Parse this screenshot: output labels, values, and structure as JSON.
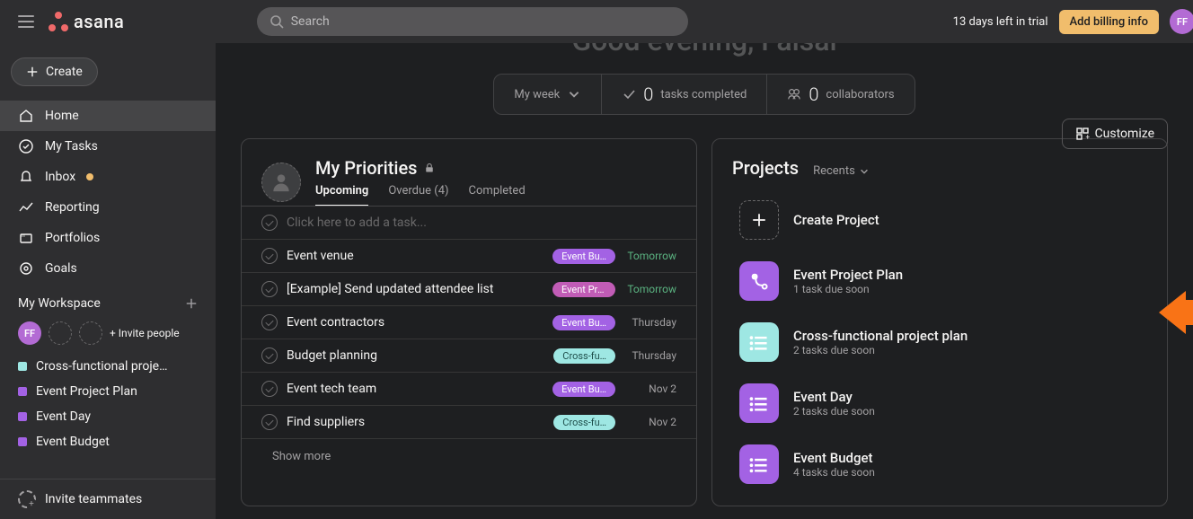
{
  "topbar": {
    "search_placeholder": "Search",
    "trial_text": "13 days left in trial",
    "billing_label": "Add billing info",
    "avatar_initials": "FF"
  },
  "sidebar": {
    "create_label": "Create",
    "nav": [
      {
        "label": "Home",
        "icon": "home",
        "active": true
      },
      {
        "label": "My Tasks",
        "icon": "check-circle"
      },
      {
        "label": "Inbox",
        "icon": "bell",
        "badge": true
      },
      {
        "label": "Reporting",
        "icon": "trend"
      },
      {
        "label": "Portfolios",
        "icon": "folder"
      },
      {
        "label": "Goals",
        "icon": "target"
      }
    ],
    "workspace_label": "My Workspace",
    "invite_label": "Invite people",
    "my_initials": "FF",
    "projects": [
      {
        "label": "Cross-functional proje…",
        "color": "#9ee7e3"
      },
      {
        "label": "Event Project Plan",
        "color": "#a362e4"
      },
      {
        "label": "Event Day",
        "color": "#a362e4"
      },
      {
        "label": "Event Budget",
        "color": "#a362e4"
      }
    ],
    "invite_teammates_label": "Invite teammates"
  },
  "hero": {
    "greeting": "Good evening, Faisal"
  },
  "stats": {
    "range_label": "My week",
    "tasks_value": "0",
    "tasks_label": "tasks completed",
    "collab_value": "0",
    "collab_label": "collaborators"
  },
  "customize_label": "Customize",
  "priorities": {
    "title": "My Priorities",
    "tabs": [
      {
        "label": "Upcoming",
        "active": true
      },
      {
        "label": "Overdue (4)"
      },
      {
        "label": "Completed"
      }
    ],
    "add_placeholder": "Click here to add a task...",
    "tasks": [
      {
        "name": "Event venue",
        "tag": "Event Bu…",
        "tag_kind": "purple",
        "due": "Tomorrow",
        "due_kind": "green"
      },
      {
        "name": "[Example] Send updated attendee list",
        "tag": "Event Pro…",
        "tag_kind": "pink",
        "due": "Tomorrow",
        "due_kind": "green"
      },
      {
        "name": "Event contractors",
        "tag": "Event Bu…",
        "tag_kind": "purple",
        "due": "Thursday",
        "due_kind": "gray"
      },
      {
        "name": "Budget planning",
        "tag": "Cross-fu…",
        "tag_kind": "teal",
        "due": "Thursday",
        "due_kind": "gray"
      },
      {
        "name": "Event tech team",
        "tag": "Event Bu…",
        "tag_kind": "purple",
        "due": "Nov 2",
        "due_kind": "gray"
      },
      {
        "name": "Find suppliers",
        "tag": "Cross-fu…",
        "tag_kind": "teal",
        "due": "Nov 2",
        "due_kind": "gray"
      }
    ],
    "show_more_label": "Show more"
  },
  "projects_panel": {
    "title": "Projects",
    "filter_label": "Recents",
    "create_label": "Create Project",
    "items": [
      {
        "name": "Event Project Plan",
        "sub": "1 task due soon",
        "color": "#a362e4",
        "icon": "flow"
      },
      {
        "name": "Cross-functional project plan",
        "sub": "2 tasks due soon",
        "color": "#9ee7e3",
        "icon": "list"
      },
      {
        "name": "Event Day",
        "sub": "2 tasks due soon",
        "color": "#a362e4",
        "icon": "list"
      },
      {
        "name": "Event Budget",
        "sub": "4 tasks due soon",
        "color": "#a362e4",
        "icon": "list"
      }
    ]
  }
}
